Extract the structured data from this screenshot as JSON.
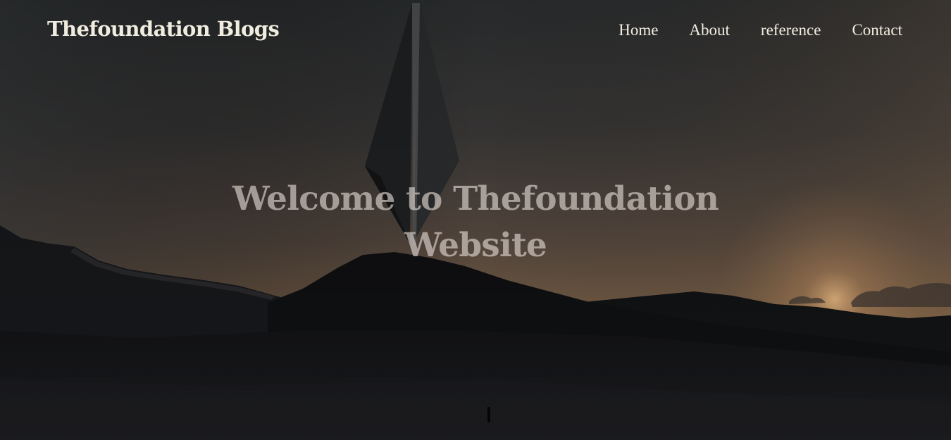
{
  "header": {
    "brand": "Thefoundation Blogs",
    "nav": [
      {
        "label": "Home"
      },
      {
        "label": "About"
      },
      {
        "label": "reference"
      },
      {
        "label": "Contact"
      }
    ]
  },
  "hero": {
    "title": "Welcome to Thefoundation Website",
    "background": "dusk-desert-monolith-image"
  },
  "colors": {
    "text": "#f1ece0",
    "heading": "#d7cfc8",
    "sky_top": "#323436",
    "sky_horizon": "#8a6a4d",
    "ground": "#0f1012"
  }
}
